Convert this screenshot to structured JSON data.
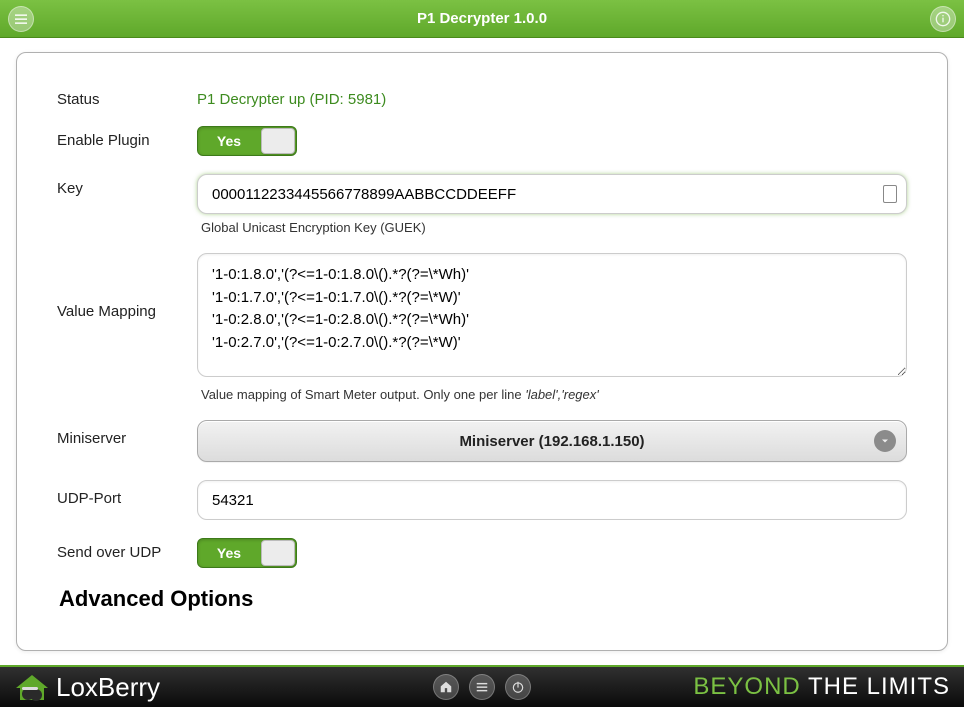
{
  "header": {
    "title": "P1 Decrypter 1.0.0"
  },
  "form": {
    "status_label": "Status",
    "status_value": "P1 Decrypter up (PID: 5981)",
    "enable_label": "Enable Plugin",
    "enable_value": "Yes",
    "key_label": "Key",
    "key_value": "0000112233445566778899AABBCCDDEEFF",
    "key_hint": "Global Unicast Encryption Key (GUEK)",
    "mapping_label": "Value Mapping",
    "mapping_value": "'1-0:1.8.0','(?<=1-0:1.8.0\\().*?(?=\\*Wh)'\n'1-0:1.7.0','(?<=1-0:1.7.0\\().*?(?=\\*W)'\n'1-0:2.8.0','(?<=1-0:2.8.0\\().*?(?=\\*Wh)'\n'1-0:2.7.0','(?<=1-0:2.7.0\\().*?(?=\\*W)'",
    "mapping_hint_prefix": "Value mapping of Smart Meter output. Only one per line ",
    "mapping_hint_italic": "'label','regex'",
    "miniserver_label": "Miniserver",
    "miniserver_value": "Miniserver (192.168.1.150)",
    "udp_label": "UDP-Port",
    "udp_value": "54321",
    "sendudp_label": "Send over UDP",
    "sendudp_value": "Yes"
  },
  "advanced_heading": "Advanced Options",
  "footer": {
    "brand": "LoxBerry",
    "slogan_beyond": "BEYOND",
    "slogan_limits": " THE LIMITS"
  }
}
